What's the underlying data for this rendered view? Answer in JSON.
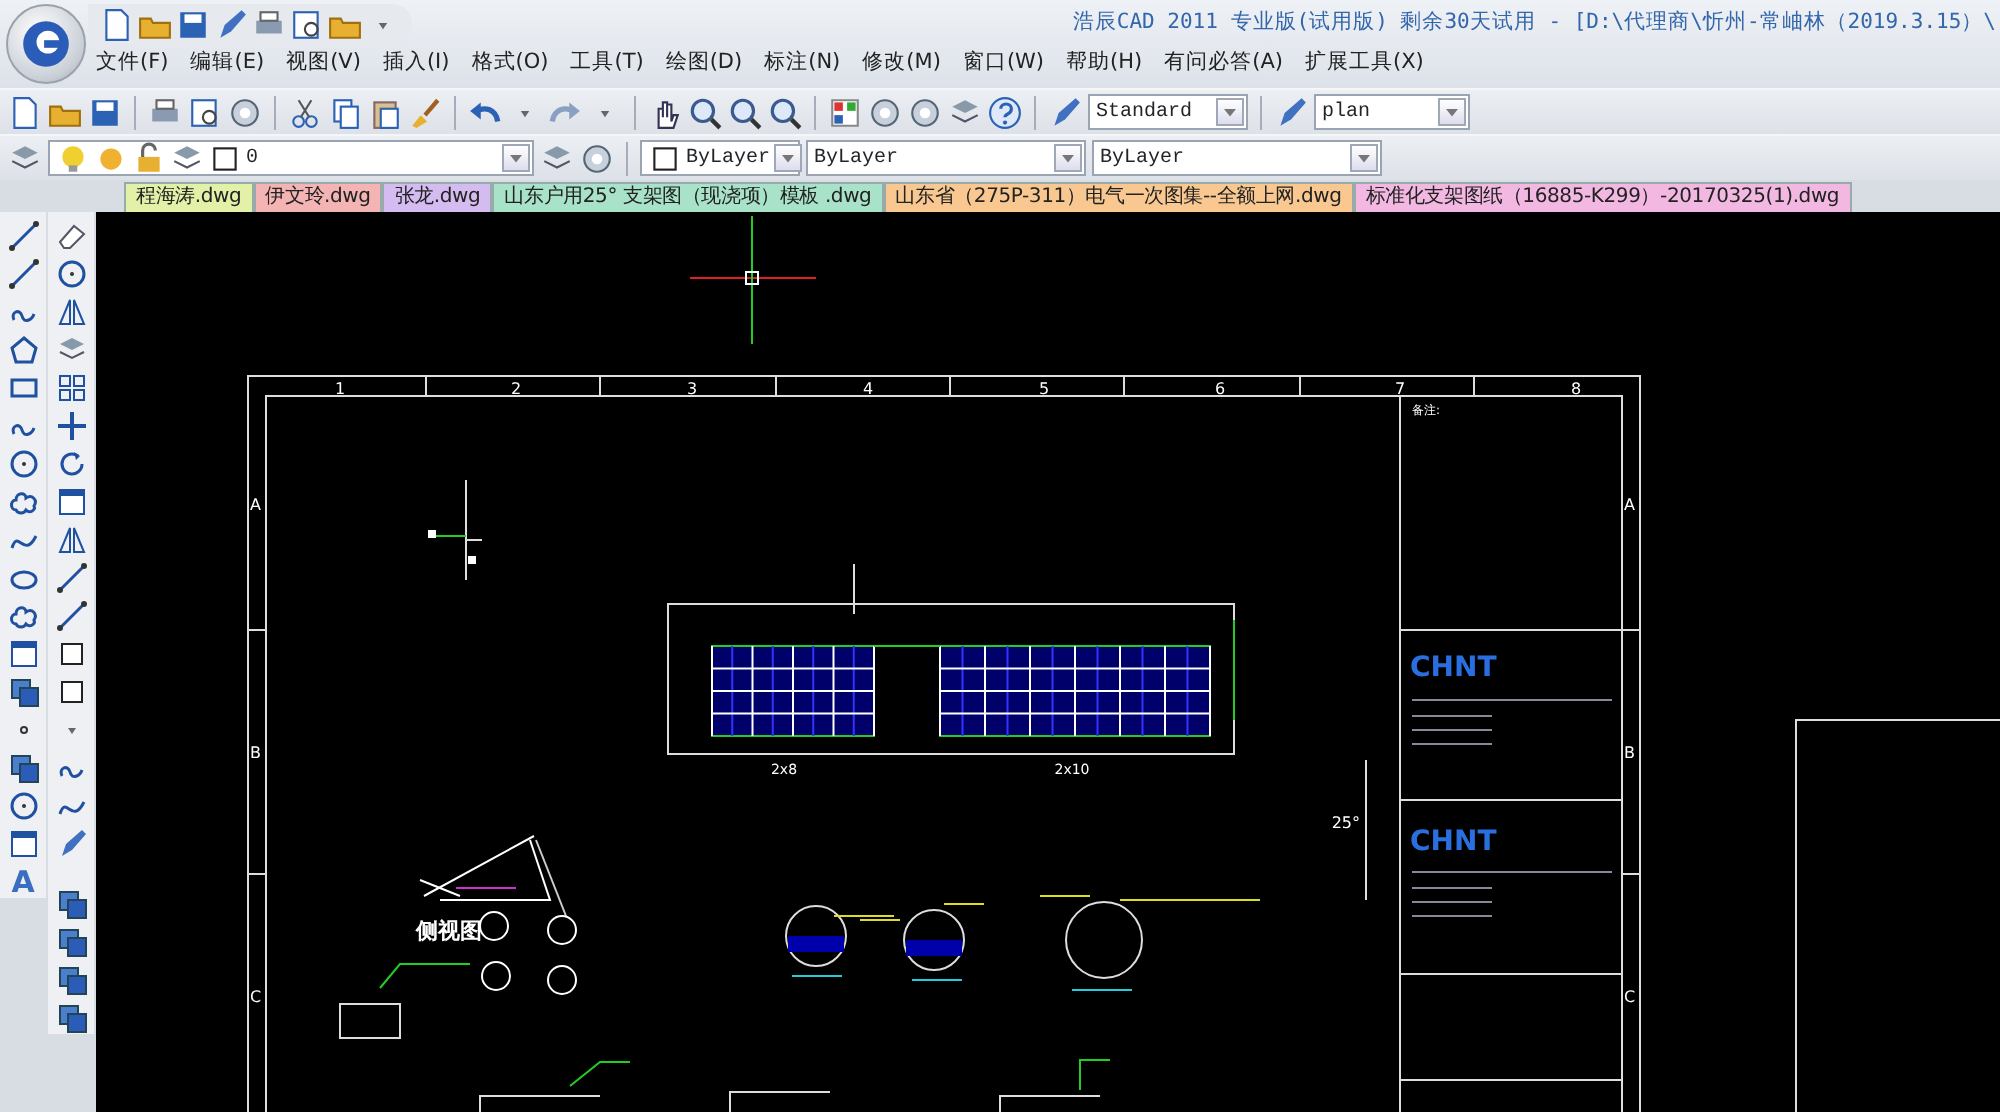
{
  "title_bar": {
    "title": "浩辰CAD 2011 专业版(试用版) 剩余30天试用 - [D:\\代理商\\忻州-常岫林（2019.3.15）\\"
  },
  "menu": [
    "文件(F)",
    "编辑(E)",
    "视图(V)",
    "插入(I)",
    "格式(O)",
    "工具(T)",
    "绘图(D)",
    "标注(N)",
    "修改(M)",
    "窗口(W)",
    "帮助(H)",
    "有问必答(A)",
    "扩展工具(X)"
  ],
  "toolbar": {
    "text_style": "Standard",
    "view": "plan"
  },
  "layer_bar": {
    "layer": "0",
    "color_setting": "ByLayer",
    "linetype": "ByLayer",
    "lineweight": "ByLayer"
  },
  "tabs": [
    {
      "label": "程海涛.dwg",
      "color": "#e2f0a8"
    },
    {
      "label": "伊文玲.dwg",
      "color": "#f4b4b4"
    },
    {
      "label": "张龙.dwg",
      "color": "#d4bcf0"
    },
    {
      "label": "山东户用25° 支架图（现浇项）模板 .dwg",
      "color": "#a8e2c8"
    },
    {
      "label": "山东省（275P-311）电气一次图集--全额上网.dwg",
      "color": "#f8c890"
    },
    {
      "label": "标准化支架图纸（16885-K299）-20170325(1).dwg",
      "color": "#f2b8e2"
    }
  ],
  "left_toolbar": {
    "text_tool": "A"
  },
  "drawing": {
    "column_numbers": [
      "1",
      "2",
      "3",
      "4",
      "5",
      "6",
      "7",
      "8"
    ],
    "row_letters_left": [
      "A",
      "B",
      "C"
    ],
    "row_letters_right": [
      "A",
      "B",
      "C"
    ],
    "notes_label": "备注:",
    "logos": [
      "CHNT",
      "CHNT"
    ],
    "array_labels": [
      "2x8",
      "2x10"
    ],
    "angle": "25°",
    "side_view_label": "侧视图"
  }
}
